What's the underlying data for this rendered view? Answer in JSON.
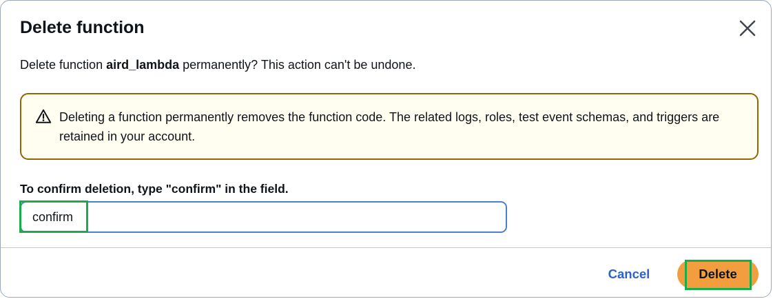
{
  "dialog": {
    "title": "Delete function",
    "description_prefix": "Delete function ",
    "function_name": "aird_lambda",
    "description_suffix": " permanently? This action can't be undone."
  },
  "alert": {
    "icon": "warning-icon",
    "text": "Deleting a function permanently removes the function code. The related logs, roles, test event schemas, and triggers are retained in your account."
  },
  "confirm": {
    "label": "To confirm deletion, type \"confirm\" in the field.",
    "value": "confirm"
  },
  "footer": {
    "cancel_label": "Cancel",
    "delete_label": "Delete"
  },
  "colors": {
    "primary_button": "#f29e3f",
    "link": "#2e62c8",
    "warning_border": "#8d6605",
    "warning_bg": "#fffef0",
    "input_focus": "#4a7fd0",
    "highlight": "#1bab4b"
  }
}
